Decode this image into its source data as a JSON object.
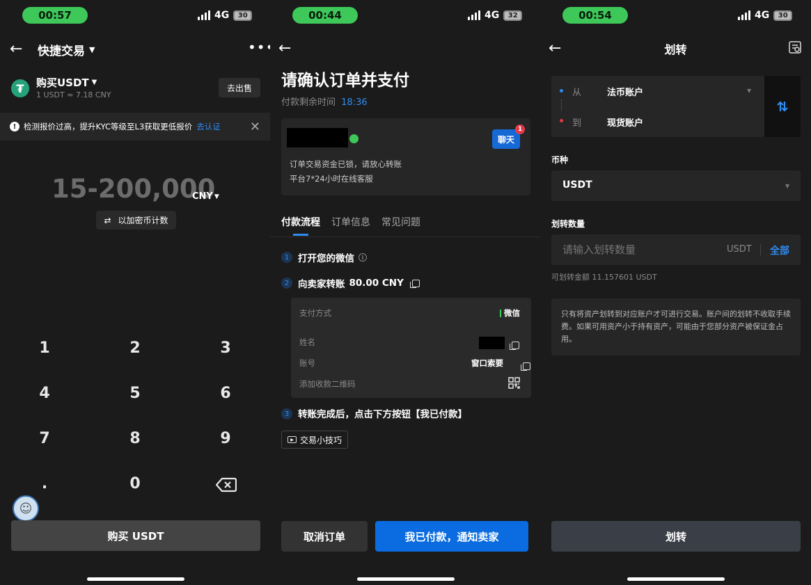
{
  "panel1": {
    "status": {
      "time": "00:57",
      "network": "4G",
      "battery": "30"
    },
    "header": {
      "title": "快捷交易"
    },
    "asset": {
      "title": "购买USDT",
      "rate": "1 USDT ≈ 7.18 CNY",
      "sell_button": "去出售"
    },
    "notice": {
      "text": "检测报价过高，提升KYC等级至L3获取更低报价",
      "link": "去认证"
    },
    "amount": {
      "range": "15-200,000",
      "currency": "CNY",
      "toggle_label": "以加密币计数"
    },
    "keypad": [
      "1",
      "2",
      "3",
      "4",
      "5",
      "6",
      "7",
      "8",
      "9",
      ".",
      "0"
    ],
    "buy_button": "购买 USDT",
    "colors": {
      "brand_green": "#26a17b"
    }
  },
  "panel2": {
    "status": {
      "time": "00:44",
      "network": "4G",
      "battery": "32"
    },
    "title": "请确认订单并支付",
    "countdown_label": "付款剩余时间",
    "countdown_value": "18:36",
    "seller_card": {
      "chat_button": "聊天",
      "chat_badge": "1",
      "notice_line1": "订单交易资金已锁，请放心转账",
      "notice_line2": "平台7*24小时在线客服"
    },
    "tabs": [
      "付款流程",
      "订单信息",
      "常见问题"
    ],
    "steps": [
      {
        "num": "1",
        "text": "打开您的微信"
      },
      {
        "num": "2",
        "text": "向卖家转账",
        "amount": "80.00 CNY"
      },
      {
        "num": "3",
        "text": "转账完成后，点击下方按钮【我已付款】"
      }
    ],
    "payment": {
      "method_label": "支付方式",
      "method_value": "微信",
      "name_label": "姓名",
      "account_label": "账号",
      "account_value": "窗口索要",
      "qr_label": "添加收款二维码"
    },
    "tips_button": "交易小技巧",
    "cancel_button": "取消订单",
    "paid_button": "我已付款，通知卖家",
    "colors": {
      "accent": "#0a6ce0",
      "wechat_green": "#3ec85a"
    }
  },
  "panel3": {
    "status": {
      "time": "00:54",
      "network": "4G",
      "battery": "30"
    },
    "title": "划转",
    "from_label": "从",
    "from_value": "法币账户",
    "to_label": "到",
    "to_value": "现货账户",
    "currency_label": "币种",
    "currency_value": "USDT",
    "amount_label": "划转数量",
    "amount_placeholder": "请输入划转数量",
    "amount_unit": "USDT",
    "all_button": "全部",
    "available": "可划转金额 11.157601 USDT",
    "notice": "只有将资产划转到对应账户才可进行交易。账户间的划转不收取手续费。如果可用资产小于持有资产，可能由于您部分资产被保证金占用。",
    "submit_button": "划转"
  }
}
